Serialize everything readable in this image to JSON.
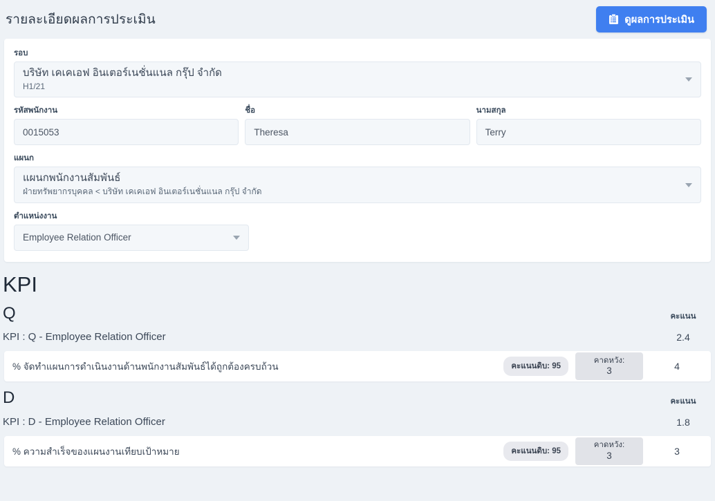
{
  "header": {
    "title": "รายละเอียดผลการประเมิน",
    "action_button": {
      "label": "ดูผลการประเมิน",
      "icon": "clipboard-list-icon",
      "color": "#3f7ff0"
    }
  },
  "form": {
    "period": {
      "label": "รอบ",
      "value_main": "บริษัท เคเคเอฟ อินเตอร์เนชั่นแนล กรุ๊ป จำกัด",
      "value_sub": "H1/21",
      "icon": "chevron-down-icon"
    },
    "employee_id": {
      "label": "รหัสพนักงาน",
      "value": "0015053"
    },
    "first_name": {
      "label": "ชื่อ",
      "value": "Theresa"
    },
    "last_name": {
      "label": "นามสกุล",
      "value": "Terry"
    },
    "department": {
      "label": "แผนก",
      "value_main": "แผนกพนักงานสัมพันธ์",
      "value_sub": "ฝ่ายทรัพยากรบุคคล < บริษัท เคเคเอฟ อินเตอร์เนชั่นแนล กรุ๊ป จำกัด",
      "icon": "chevron-down-icon"
    },
    "position": {
      "label": "ตำแหน่งงาน",
      "value": "Employee Relation Officer",
      "icon": "chevron-down-icon"
    }
  },
  "kpi": {
    "section_title": "KPI",
    "score_column_label": "คะแนน",
    "groups": [
      {
        "letter": "Q",
        "score_column_label": "คะแนน",
        "summary_label": "KPI : Q - Employee Relation Officer",
        "summary_score": "2.4",
        "items": [
          {
            "name": "% จัดทำแผนการดำเนินงานด้านพนักงานสัมพันธ์ได้ถูกต้องครบถ้วน",
            "raw_badge": "คะแนนดิบ: 95",
            "expect_label": "คาดหวัง:",
            "expect_value": "3",
            "score": "4"
          }
        ]
      },
      {
        "letter": "D",
        "score_column_label": "คะแนน",
        "summary_label": "KPI : D - Employee Relation Officer",
        "summary_score": "1.8",
        "items": [
          {
            "name": "% ความสำเร็จของแผนงานเทียบเป้าหมาย",
            "raw_badge": "คะแนนดิบ: 95",
            "expect_label": "คาดหวัง:",
            "expect_value": "3",
            "score": "3"
          }
        ]
      }
    ]
  }
}
